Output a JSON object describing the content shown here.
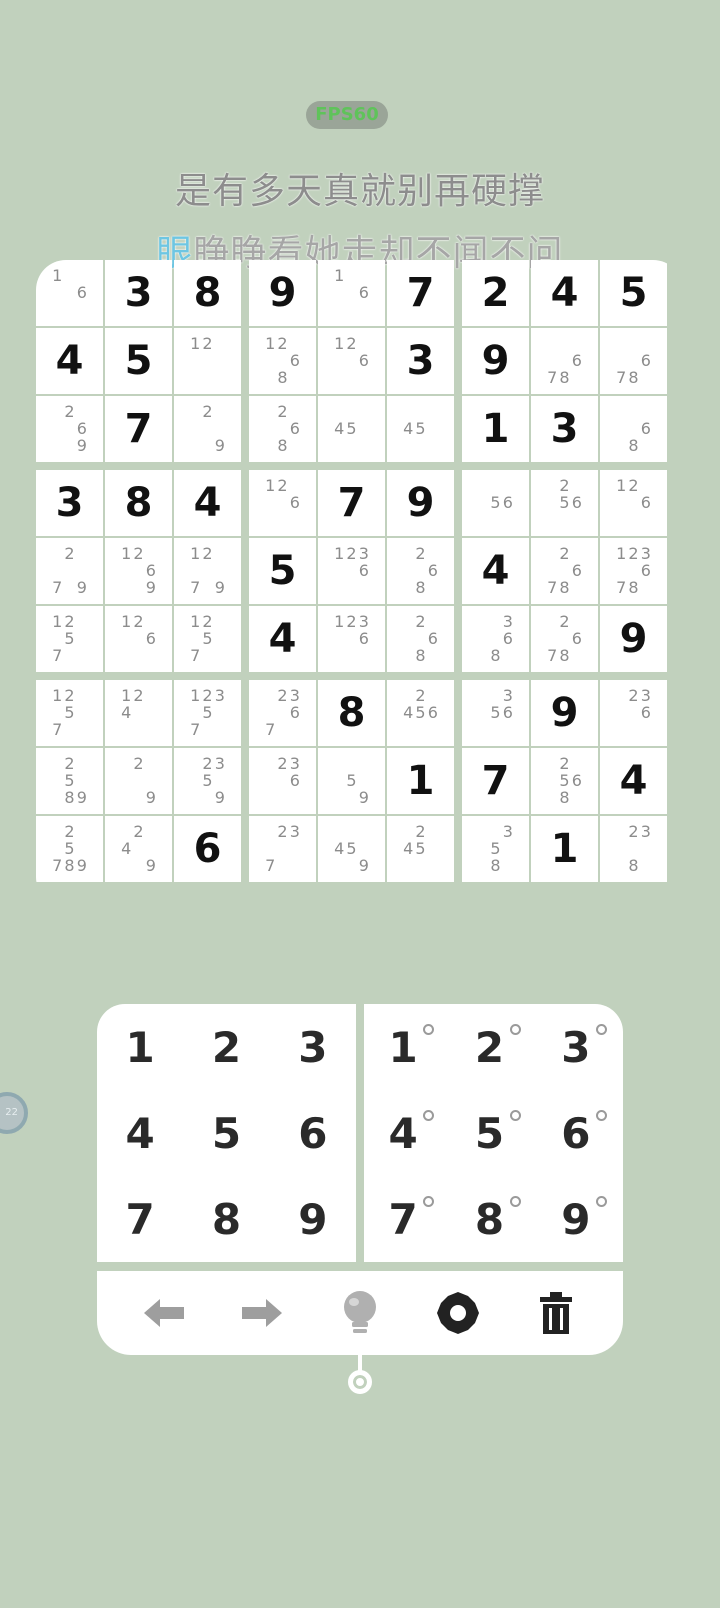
{
  "fps_label": "FPS60",
  "lyrics": {
    "line1": "是有多天真就别再硬撑",
    "line2_highlight": "眼",
    "line2_rest": "睁睁看她走却不闻不问"
  },
  "board": [
    [
      {
        "n": [
          "1",
          "6"
        ]
      },
      {
        "v": "3"
      },
      {
        "v": "8"
      },
      {
        "v": "9"
      },
      {
        "n": [
          "1",
          "6"
        ]
      },
      {
        "v": "7"
      },
      {
        "v": "2"
      },
      {
        "v": "4"
      },
      {
        "v": "5"
      }
    ],
    [
      {
        "v": "4"
      },
      {
        "v": "5"
      },
      {
        "n": [
          "1",
          "2"
        ]
      },
      {
        "n": [
          "1",
          "2",
          "6",
          "8"
        ]
      },
      {
        "n": [
          "1",
          "2",
          "6"
        ]
      },
      {
        "v": "3"
      },
      {
        "v": "9"
      },
      {
        "n": [
          "6",
          "7",
          "8"
        ]
      },
      {
        "n": [
          "6",
          "7",
          "8"
        ]
      }
    ],
    [
      {
        "n": [
          "2",
          "6",
          "9"
        ]
      },
      {
        "v": "7"
      },
      {
        "n": [
          "2",
          "9"
        ]
      },
      {
        "n": [
          "2",
          "6",
          "8"
        ]
      },
      {
        "n": [
          "4",
          "5"
        ]
      },
      {
        "n": [
          "4",
          "5"
        ]
      },
      {
        "v": "1"
      },
      {
        "v": "3"
      },
      {
        "n": [
          "6",
          "8"
        ]
      }
    ],
    [
      {
        "v": "3"
      },
      {
        "v": "8"
      },
      {
        "v": "4"
      },
      {
        "n": [
          "1",
          "2",
          "6"
        ]
      },
      {
        "v": "7"
      },
      {
        "v": "9"
      },
      {
        "n": [
          "5",
          "6"
        ]
      },
      {
        "n": [
          "2",
          "5",
          "6"
        ]
      },
      {
        "n": [
          "1",
          "2",
          "6"
        ]
      }
    ],
    [
      {
        "n": [
          "2",
          "7",
          "9"
        ]
      },
      {
        "n": [
          "1",
          "2",
          "6",
          "9"
        ]
      },
      {
        "n": [
          "1",
          "2",
          "7",
          "9"
        ]
      },
      {
        "v": "5"
      },
      {
        "n": [
          "1",
          "2",
          "3",
          "6"
        ]
      },
      {
        "n": [
          "2",
          "6",
          "8"
        ]
      },
      {
        "v": "4"
      },
      {
        "n": [
          "2",
          "6",
          "7",
          "8"
        ]
      },
      {
        "n": [
          "1",
          "2",
          "3",
          "6",
          "7",
          "8"
        ]
      }
    ],
    [
      {
        "n": [
          "1",
          "2",
          "5",
          "7"
        ]
      },
      {
        "n": [
          "1",
          "2",
          "6"
        ]
      },
      {
        "n": [
          "1",
          "2",
          "5",
          "7"
        ]
      },
      {
        "v": "4"
      },
      {
        "n": [
          "1",
          "2",
          "3",
          "6"
        ]
      },
      {
        "n": [
          "2",
          "6",
          "8"
        ]
      },
      {
        "n": [
          "3",
          "6",
          "8"
        ]
      },
      {
        "n": [
          "2",
          "6",
          "7",
          "8"
        ]
      },
      {
        "v": "9"
      }
    ],
    [
      {
        "n": [
          "1",
          "2",
          "5",
          "7"
        ]
      },
      {
        "n": [
          "1",
          "2",
          "4"
        ]
      },
      {
        "n": [
          "1",
          "2",
          "3",
          "5",
          "7"
        ]
      },
      {
        "n": [
          "2",
          "3",
          "6",
          "7"
        ]
      },
      {
        "v": "8"
      },
      {
        "n": [
          "2",
          "4",
          "5",
          "6"
        ]
      },
      {
        "n": [
          "3",
          "5",
          "6"
        ]
      },
      {
        "v": "9"
      },
      {
        "n": [
          "2",
          "3",
          "6"
        ]
      }
    ],
    [
      {
        "n": [
          "2",
          "5",
          "8",
          "9"
        ]
      },
      {
        "n": [
          "2",
          "9"
        ]
      },
      {
        "n": [
          "2",
          "3",
          "5",
          "9"
        ]
      },
      {
        "n": [
          "2",
          "3",
          "6"
        ]
      },
      {
        "n": [
          "5",
          "9"
        ]
      },
      {
        "v": "1"
      },
      {
        "v": "7"
      },
      {
        "n": [
          "2",
          "5",
          "6",
          "8"
        ]
      },
      {
        "v": "4"
      }
    ],
    [
      {
        "n": [
          "2",
          "5",
          "7",
          "8",
          "9"
        ]
      },
      {
        "n": [
          "2",
          "4",
          "9"
        ]
      },
      {
        "v": "6"
      },
      {
        "n": [
          "2",
          "3",
          "7"
        ]
      },
      {
        "n": [
          "4",
          "5",
          "9"
        ]
      },
      {
        "n": [
          "2",
          "4",
          "5"
        ]
      },
      {
        "n": [
          "3",
          "5",
          "8"
        ]
      },
      {
        "v": "1"
      },
      {
        "n": [
          "2",
          "3",
          "8"
        ]
      }
    ]
  ],
  "pad_digits": [
    "1",
    "2",
    "3",
    "4",
    "5",
    "6",
    "7",
    "8",
    "9"
  ],
  "side_bubble_text": "22",
  "toolbar": {
    "undo_icon": "arrow-left-icon",
    "redo_icon": "arrow-right-icon",
    "hint_icon": "lightbulb-icon",
    "settings_icon": "gear-icon",
    "delete_icon": "trash-icon"
  },
  "colors": {
    "background": "#c1d1bd",
    "cell": "#ffffff",
    "digit": "#111111",
    "note": "#8c8c8c",
    "fps_text": "#5fc35a",
    "lyric_highlight": "#6ec6e2"
  }
}
